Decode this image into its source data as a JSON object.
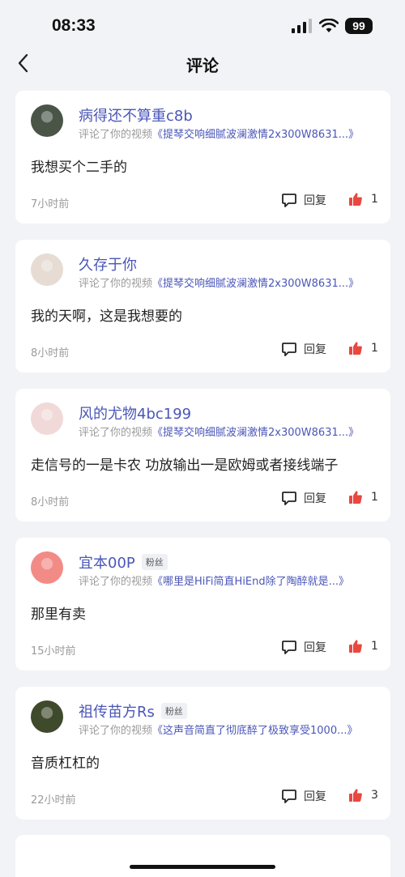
{
  "status_bar": {
    "time": "08:33",
    "battery": "99"
  },
  "header": {
    "title": "评论"
  },
  "comments": [
    {
      "username": "病得还不算重c8b",
      "badge": "",
      "action_text": "评论了你的视频",
      "video_title": "《提琴交响细腻波澜激情2x300W8631...》",
      "text": "我想买个二手的",
      "time": "7小时前",
      "reply_label": "回复",
      "likes": "1",
      "avatar_color": "#4a5548"
    },
    {
      "username": "久存于你",
      "badge": "",
      "action_text": "评论了你的视频",
      "video_title": "《提琴交响细腻波澜激情2x300W8631...》",
      "text": "我的天啊，这是我想要的",
      "time": "8小时前",
      "reply_label": "回复",
      "likes": "1",
      "avatar_color": "#e6dcd4"
    },
    {
      "username": "风的尤物4bc199",
      "badge": "",
      "action_text": "评论了你的视频",
      "video_title": "《提琴交响细腻波澜激情2x300W8631...》",
      "text": "走信号的一是卡农 功放输出一是欧姆或者接线端子",
      "time": "8小时前",
      "reply_label": "回复",
      "likes": "1",
      "avatar_color": "#f1d9d9"
    },
    {
      "username": "宜本00P",
      "badge": "粉丝",
      "action_text": "评论了你的视频",
      "video_title": "《哪里是HiFi简直HiEnd除了陶醉就是...》",
      "text": "那里有卖",
      "time": "15小时前",
      "reply_label": "回复",
      "likes": "1",
      "avatar_color": "#f28b86"
    },
    {
      "username": "祖传苗方Rs",
      "badge": "粉丝",
      "action_text": "评论了你的视频",
      "video_title": "《这声音简直了彻底醉了极致享受1000...》",
      "text": "音质杠杠的",
      "time": "22小时前",
      "reply_label": "回复",
      "likes": "3",
      "avatar_color": "#3f4a2c"
    }
  ],
  "colors": {
    "accent": "#4a56b8",
    "like": "#e8483f",
    "background": "#f2f3f7"
  }
}
